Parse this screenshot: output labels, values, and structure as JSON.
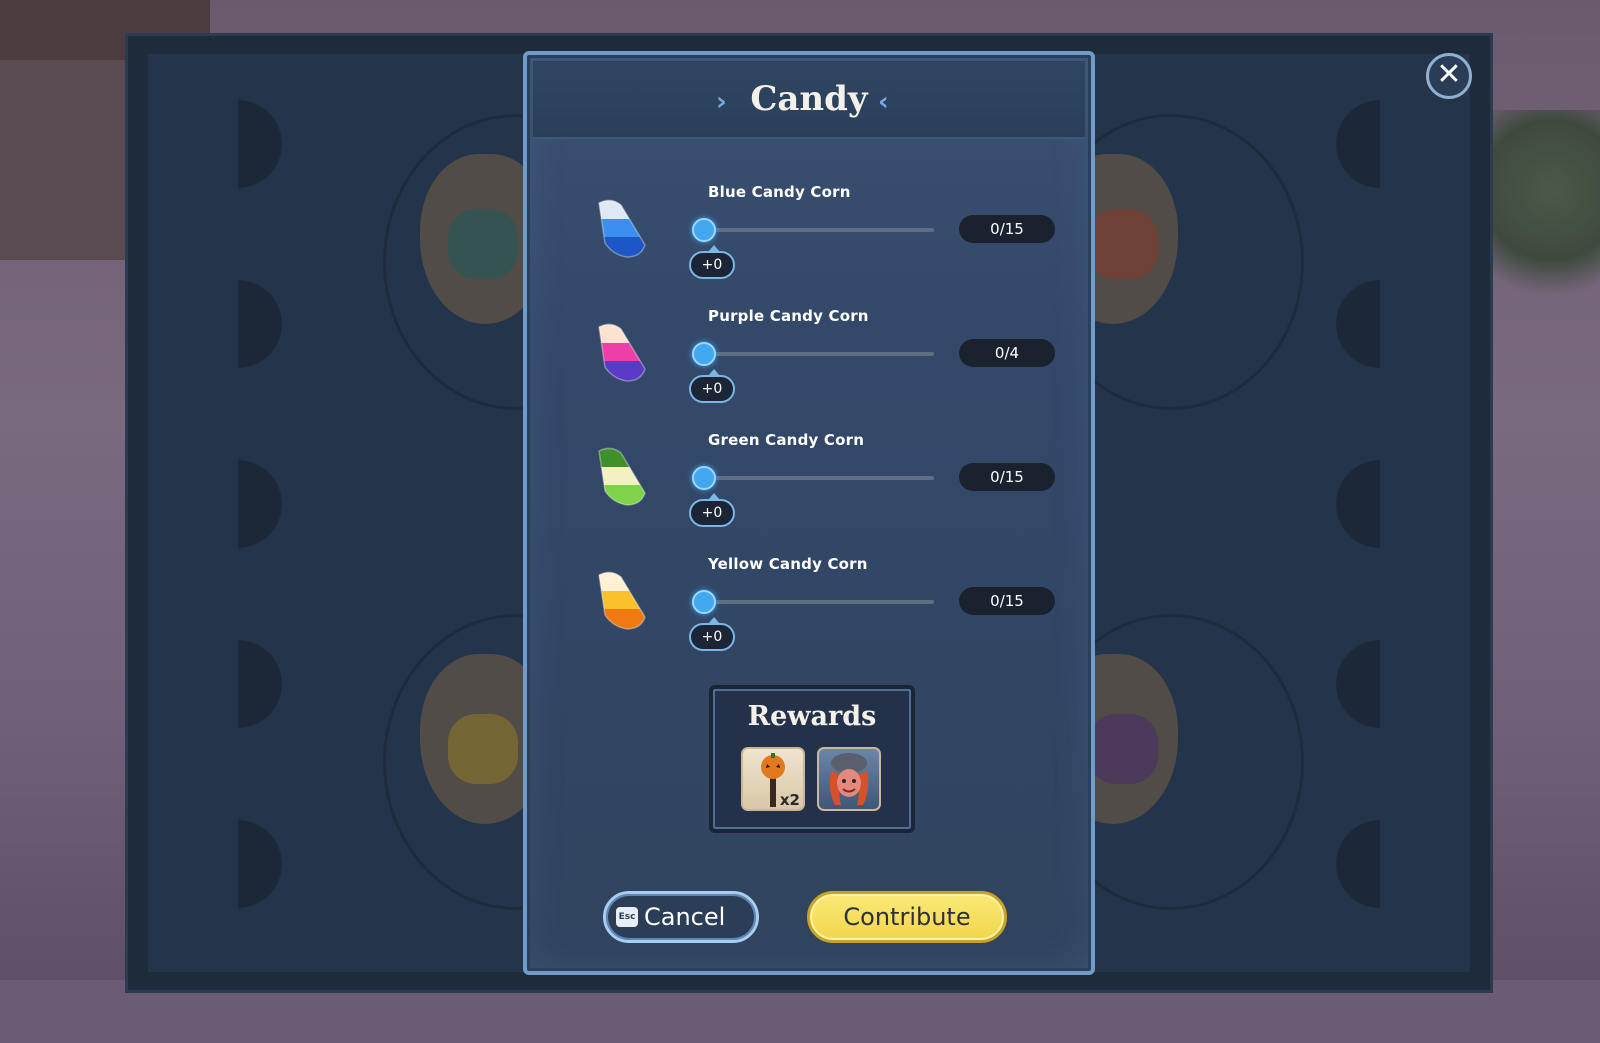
{
  "dialog": {
    "title": "Candy",
    "items": [
      {
        "name": "Blue Candy Corn",
        "delta": "+0",
        "count": "0/15",
        "slider_fraction": 0,
        "colors": [
          "#dfe9f6",
          "#3a8ff0",
          "#1d56c6"
        ]
      },
      {
        "name": "Purple Candy Corn",
        "delta": "+0",
        "count": "0/4",
        "slider_fraction": 0,
        "colors": [
          "#fbe3cf",
          "#ee3fa8",
          "#5a3bc8"
        ]
      },
      {
        "name": "Green Candy Corn",
        "delta": "+0",
        "count": "0/15",
        "slider_fraction": 0,
        "colors": [
          "#3f8f2b",
          "#f3f0c2",
          "#7fd34a"
        ]
      },
      {
        "name": "Yellow Candy Corn",
        "delta": "+0",
        "count": "0/15",
        "slider_fraction": 0,
        "colors": [
          "#fff0d6",
          "#f9c22c",
          "#f07a12"
        ]
      }
    ],
    "rewards": {
      "title": "Rewards",
      "items": [
        {
          "icon": "pumpkin-staff-icon",
          "qty": "x2"
        },
        {
          "icon": "character-portrait-icon",
          "qty": ""
        }
      ]
    },
    "buttons": {
      "esc_key": "Esc",
      "cancel": "Cancel",
      "contribute": "Contribute"
    },
    "close_icon": "close-icon"
  },
  "colors": {
    "accent": "#41a8f0",
    "contribute_bg": "#f1d64a",
    "panel_border": "#6f9cc8"
  }
}
